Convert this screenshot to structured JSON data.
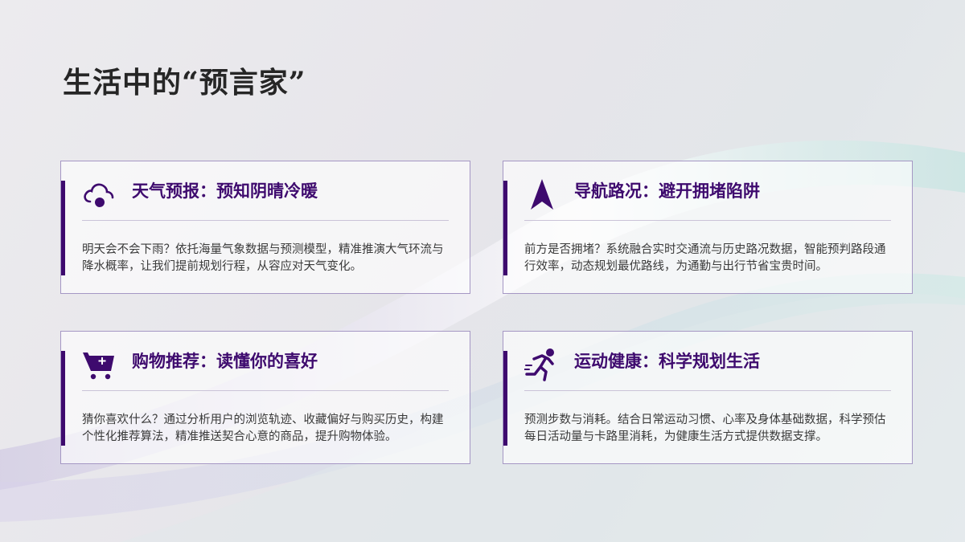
{
  "page": {
    "title": "生活中的“预言家”"
  },
  "colors": {
    "accent": "#3e0a6e",
    "card_border": "#a597c4",
    "text": "#3a3a3a"
  },
  "cards": [
    {
      "icon": "cloud-icon",
      "heading": "天气预报：预知阴晴冷暖",
      "description": "明天会不会下雨？依托海量气象数据与预测模型，精准推演大气环流与降水概率，让我们提前规划行程，从容应对天气变化。"
    },
    {
      "icon": "navigation-arrow-icon",
      "heading": "导航路况：避开拥堵陷阱",
      "description": "前方是否拥堵？系统融合实时交通流与历史路况数据，智能预判路段通行效率，动态规划最优路线，为通勤与出行节省宝贵时间。"
    },
    {
      "icon": "shopping-cart-icon",
      "heading": "购物推荐：读懂你的喜好",
      "description": "猜你喜欢什么？通过分析用户的浏览轨迹、收藏偏好与购买历史，构建个性化推荐算法，精准推送契合心意的商品，提升购物体验。"
    },
    {
      "icon": "runner-icon",
      "heading": "运动健康：科学规划生活",
      "description": "预测步数与消耗。结合日常运动习惯、心率及身体基础数据，科学预估每日活动量与卡路里消耗，为健康生活方式提供数据支撑。"
    }
  ]
}
